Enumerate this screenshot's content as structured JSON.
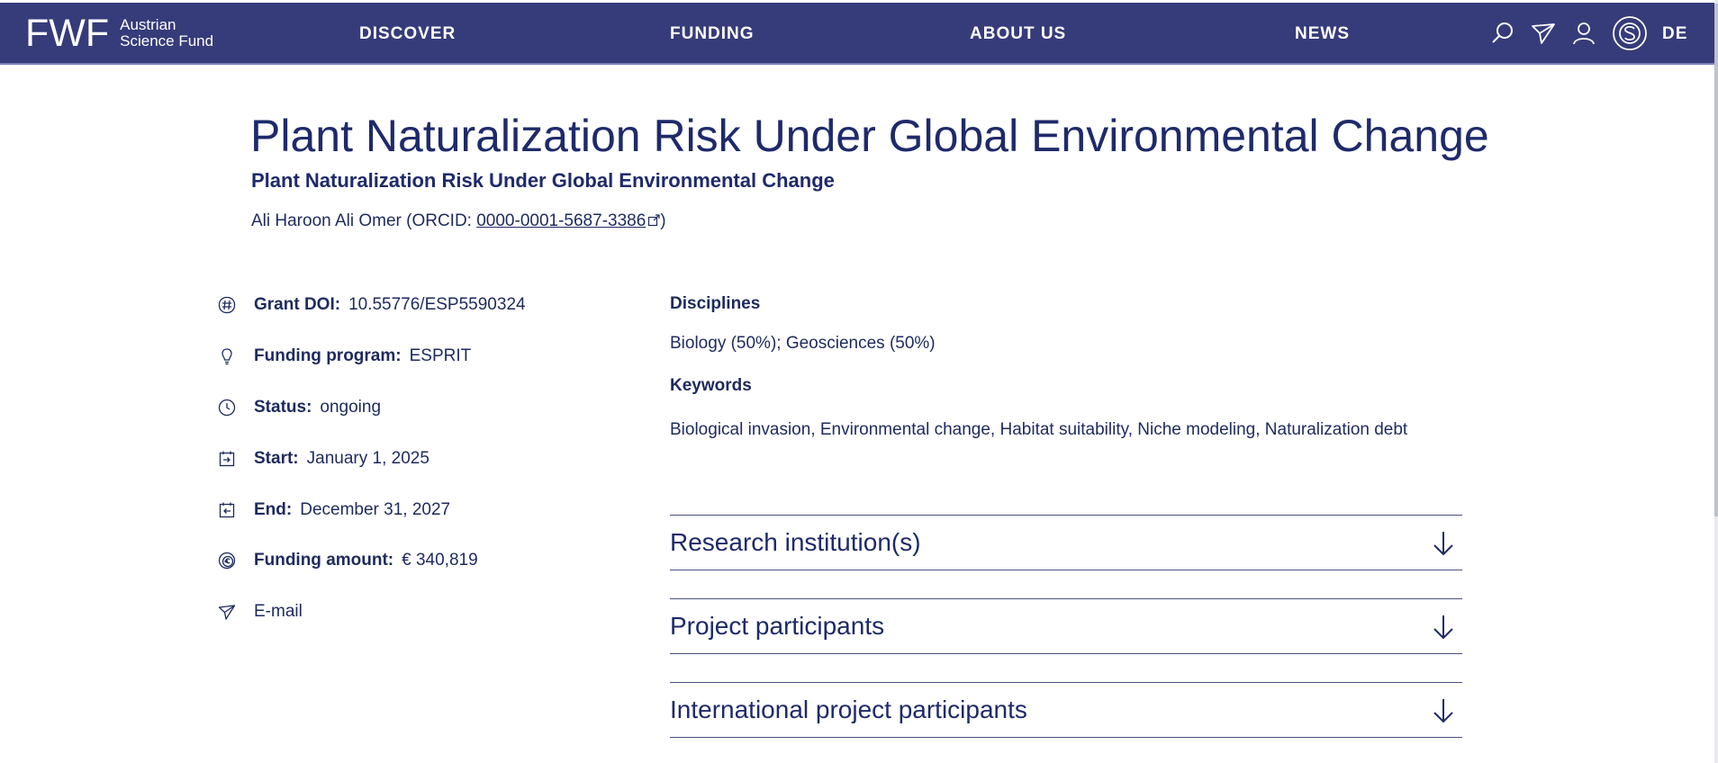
{
  "header": {
    "logo_mark": "FWF",
    "logo_line1": "Austrian",
    "logo_line2": "Science Fund",
    "nav": [
      "DISCOVER",
      "FUNDING",
      "ABOUT US",
      "NEWS"
    ],
    "icons": [
      "search-icon",
      "send-icon",
      "user-icon",
      "s-circle-icon"
    ],
    "lang": "DE",
    "bg_color": "#363b7a"
  },
  "project": {
    "title": "Plant Naturalization Risk Under Global Environmental Change",
    "subtitle": "Plant Naturalization Risk Under Global Environmental Change",
    "author_prefix": "Ali Haroon Ali Omer (ORCID: ",
    "orcid": "0000-0001-5687-3386",
    "author_suffix": ")"
  },
  "meta": {
    "grant_doi_label": "Grant DOI:",
    "grant_doi": "10.55776/ESP5590324",
    "program_label": "Funding program:",
    "program": "ESPRIT",
    "status_label": "Status:",
    "status": "ongoing",
    "start_label": "Start:",
    "start": "January 1, 2025",
    "end_label": "End:",
    "end": "December 31, 2027",
    "amount_label": "Funding amount:",
    "amount": "€ 340,819",
    "email": "E-mail"
  },
  "details": {
    "disciplines_heading": "Disciplines",
    "disciplines": "Biology (50%); Geosciences (50%)",
    "keywords_heading": "Keywords",
    "keywords": "Biological invasion, Environmental change, Habitat suitability, Niche modeling, Naturalization debt"
  },
  "accordions": [
    "Research institution(s)",
    "Project participants",
    "International project participants"
  ]
}
